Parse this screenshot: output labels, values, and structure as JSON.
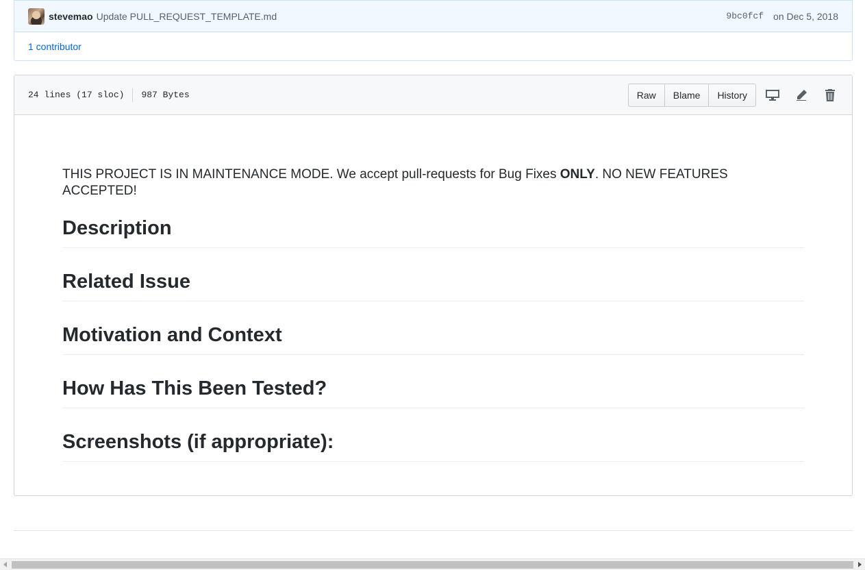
{
  "commit": {
    "author": "stevemao",
    "message": "Update PULL_REQUEST_TEMPLATE.md",
    "sha": "9bc0fcf",
    "date": "on Dec 5, 2018"
  },
  "contributors": {
    "label": "1 contributor"
  },
  "file": {
    "lines_info": "24 lines (17 sloc)",
    "size": "987 Bytes",
    "buttons": {
      "raw": "Raw",
      "blame": "Blame",
      "history": "History"
    },
    "icons": [
      "desktop-icon",
      "pencil-icon",
      "trash-icon"
    ]
  },
  "markdown": {
    "notice_prefix": "THIS PROJECT IS IN MAINTENANCE MODE. We accept pull-requests for Bug Fixes ",
    "notice_bold": "ONLY",
    "notice_suffix": ". NO NEW FEATURES ACCEPTED!",
    "headings": [
      "Description",
      "Related Issue",
      "Motivation and Context",
      "How Has This Been Tested?",
      "Screenshots (if appropriate):"
    ]
  }
}
